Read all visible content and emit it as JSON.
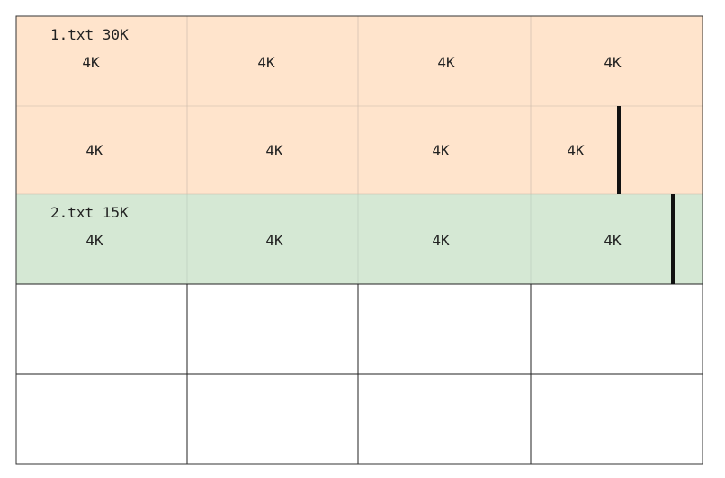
{
  "rows": [
    {
      "kind": "file",
      "fill": "#ffe4cc",
      "file_label": "1.txt 30K",
      "cells": [
        "4K",
        "4K",
        "4K",
        "4K"
      ]
    },
    {
      "kind": "file",
      "fill": "#ffe4cc",
      "file_label": "",
      "cells": [
        "4K",
        "4K",
        "4K",
        "4K"
      ]
    },
    {
      "kind": "file",
      "fill": "#d5e8d4",
      "file_label": "2.txt 15K",
      "cells": [
        "4K",
        "4K",
        "4K",
        "4K"
      ]
    },
    {
      "kind": "empty",
      "fill": "#ffffff",
      "file_label": "",
      "cells": [
        "",
        "",
        "",
        ""
      ]
    },
    {
      "kind": "empty",
      "fill": "#ffffff",
      "file_label": "",
      "cells": [
        "",
        "",
        "",
        ""
      ]
    }
  ],
  "colors": {
    "file1": "#ffe4cc",
    "file2": "#d5e8d4",
    "empty": "#ffffff",
    "marker": "#111111"
  }
}
